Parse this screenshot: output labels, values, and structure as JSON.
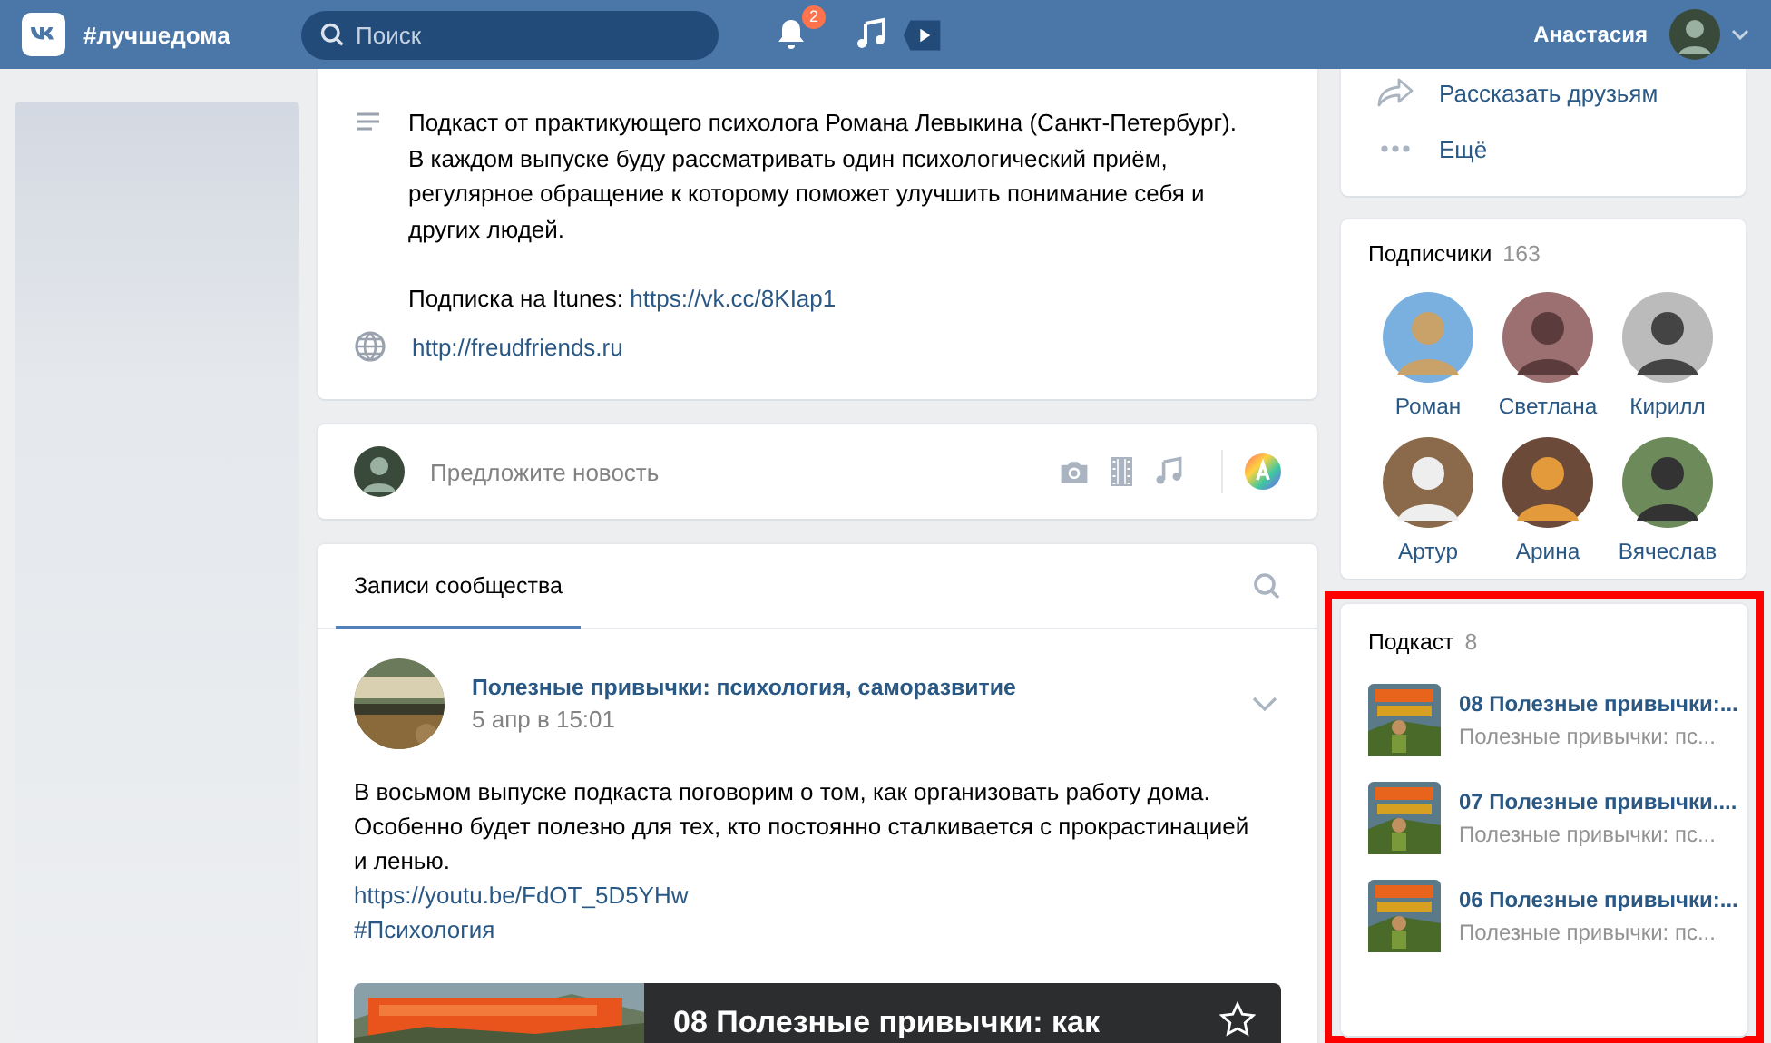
{
  "header": {
    "hashtag": "#лучшедома",
    "search": {
      "placeholder": "Поиск"
    },
    "notifications": "2",
    "user": "Анастасия"
  },
  "about": {
    "description": [
      "Подкаст от практикующего психолога Романа Левыкина (Санкт-Петербург).",
      "В каждом выпуске буду рассматривать один психологический приём,",
      "регулярное обращение к которому поможет улучшить понимание себя и",
      "других людей."
    ],
    "subscription_label": "Подписка на Itunes:",
    "subscription_link": "https://vk.cc/8KIap1",
    "website": "http://freudfriends.ru"
  },
  "suggest": {
    "placeholder": "Предложите новость"
  },
  "wall": {
    "tabs": [
      {
        "label": "Записи сообщества",
        "selected": true
      }
    ],
    "post": {
      "author": "Полезные привычки: психология, саморазвитие",
      "date": "5 апр в 15:01",
      "text": [
        "В восьмом выпуске подкаста поговорим о том, как организовать работу дома.",
        "Особенно будет полезно для тех, кто постоянно сталкивается с прокрастинацией",
        "и ленью."
      ],
      "link": "https://youtu.be/FdOT_5D5YHw",
      "hashtag": "#Психология",
      "attachment_title": "08 Полезные привычки: как"
    }
  },
  "actions": [
    {
      "kind": "share",
      "label": "Рассказать друзьям"
    },
    {
      "kind": "more",
      "label": "Ещё"
    }
  ],
  "subscribers": {
    "title": "Подписчики",
    "count": "163",
    "people": [
      {
        "name": "Роман"
      },
      {
        "name": "Светлана"
      },
      {
        "name": "Кирилл"
      },
      {
        "name": "Артур"
      },
      {
        "name": "Арина"
      },
      {
        "name": "Вячеслав"
      }
    ]
  },
  "podcast": {
    "title": "Подкаст",
    "count": "8",
    "highlighted": true,
    "episodes": [
      {
        "title": "08 Полезные привычки:...",
        "subtitle": "Полезные привычки: пс..."
      },
      {
        "title": "07 Полезные привычки....",
        "subtitle": "Полезные привычки: пс..."
      },
      {
        "title": "06 Полезные привычки:...",
        "subtitle": "Полезные привычки: пс..."
      }
    ]
  }
}
